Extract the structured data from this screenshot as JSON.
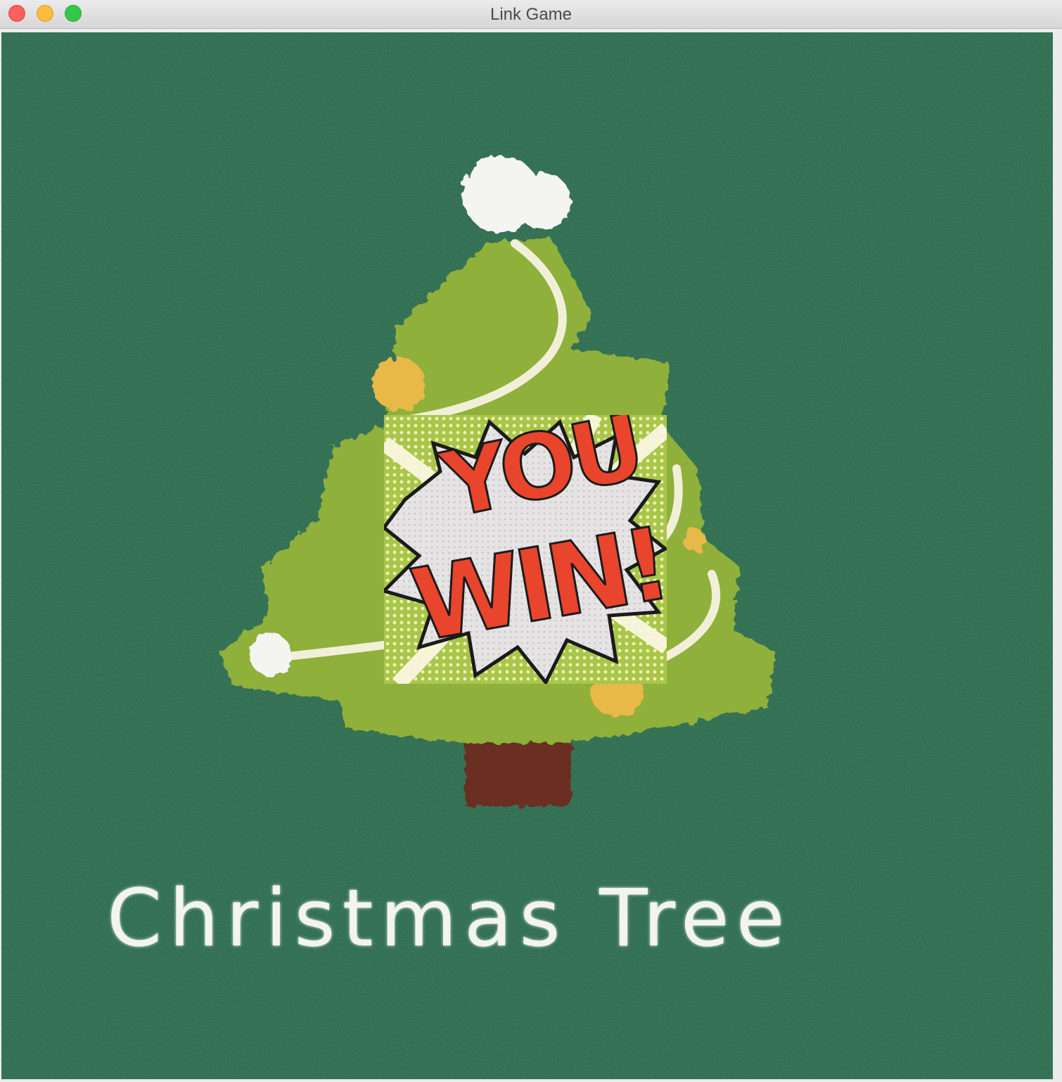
{
  "window": {
    "title": "Link Game"
  },
  "board": {
    "caption": "Christmas Tree",
    "background_color": "#1f5a3d",
    "tree_color": "#8fb03a"
  },
  "win_overlay": {
    "line1": "YOU",
    "line2": "WIN!!!",
    "text_color": "#e8452c"
  }
}
